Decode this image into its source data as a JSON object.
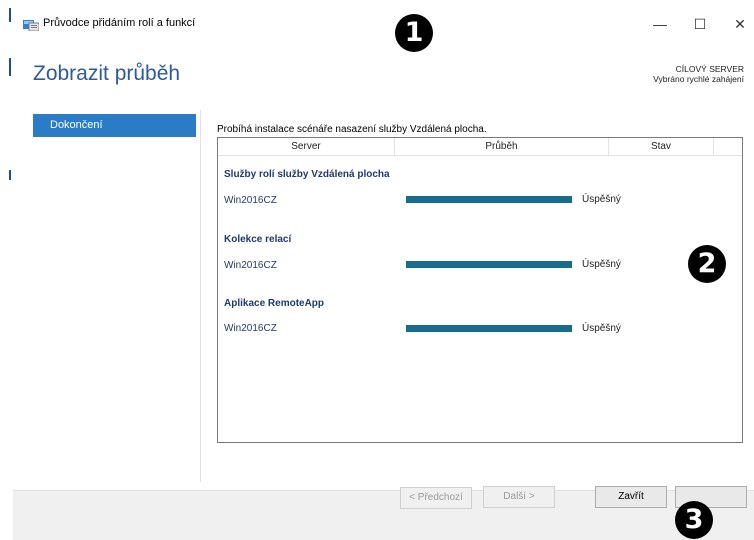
{
  "window": {
    "title": "Průvodce přidáním rolí a funkcí",
    "minimize_glyph": "—",
    "maximize_glyph": "☐",
    "close_glyph": "✕"
  },
  "page": {
    "heading": "Zobrazit průběh",
    "server_label": "CÍLOVÝ SERVER",
    "server_value": "Vybráno rychlé zahájení"
  },
  "nav": {
    "items": [
      {
        "label": "Dokončení",
        "selected": true
      }
    ]
  },
  "progress": {
    "intro": "Probíhá instalace scénáře nasazení služby Vzdálená plocha.",
    "columns": [
      "Server",
      "Průběh",
      "Stav"
    ],
    "groups": [
      {
        "title": "Služby rolí služby Vzdálená plocha",
        "rows": [
          {
            "server": "Win2016CZ",
            "progress": 1.0,
            "status": "Úspěšný"
          }
        ]
      },
      {
        "title": "Kolekce relací",
        "rows": [
          {
            "server": "Win2016CZ",
            "progress": 1.0,
            "status": "Úspěšný"
          }
        ]
      },
      {
        "title": "Aplikace RemoteApp",
        "rows": [
          {
            "server": "Win2016CZ",
            "progress": 1.0,
            "status": "Úspěšný"
          }
        ]
      }
    ]
  },
  "footer": {
    "previous": "< Předchozí",
    "next": "Další >",
    "close": "Zavřít"
  },
  "annotations": {
    "badge1": "1",
    "badge2": "2",
    "badge3": "3"
  },
  "colors": {
    "accent": "#2b7cc6",
    "heading": "#2d5b9a",
    "progress": "#176d90"
  }
}
